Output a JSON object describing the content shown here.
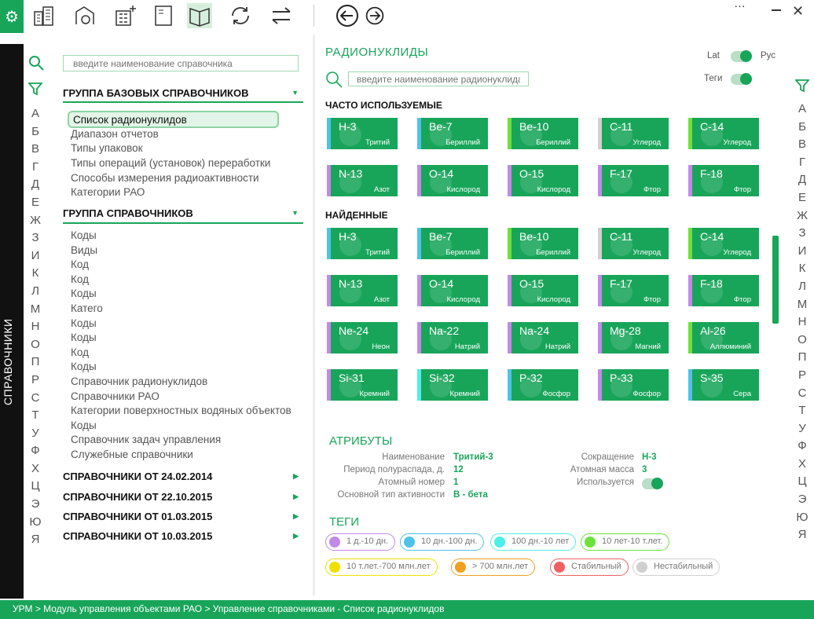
{
  "toolbar": {
    "settings_icon": "gear-icon"
  },
  "left": {
    "tab_label": "СПРАВОЧНИКИ",
    "search_placeholder": "введите наименование справочника",
    "alphabet": [
      "А",
      "Б",
      "В",
      "Г",
      "Д",
      "Е",
      "Ж",
      "З",
      "И",
      "К",
      "Л",
      "М",
      "Н",
      "О",
      "П",
      "Р",
      "С",
      "Т",
      "У",
      "Ф",
      "Х",
      "Ц",
      "Э",
      "Ю",
      "Я"
    ],
    "group1": {
      "title": "ГРУППА БАЗОВЫХ СПРАВОЧНИКОВ",
      "items": [
        "Список радионуклидов",
        "Диапазон отчетов",
        "Типы упаковок",
        "Типы операций (установок) переработки",
        "Способы измерения радиоактивности",
        "Категории РАО"
      ]
    },
    "group2": {
      "title": "ГРУППА СПРАВОЧНИКОВ",
      "items": [
        "Коды",
        "Виды",
        "Код",
        "Код",
        "Коды",
        "Катего",
        "Коды",
        "Коды",
        "Код",
        "Коды",
        "Справочник радионуклидов",
        "Справочники РАО",
        "Категории поверхностных водяных объектов",
        "Коды",
        "Справочник задач управления",
        "Служебные справочники"
      ]
    },
    "collapsed": [
      "СПРАВОЧНИКИ ОТ 24.02.2014",
      "СПРАВОЧНИКИ ОТ 22.10.2015",
      "СПРАВОЧНИКИ ОТ 01.03.2015",
      "СПРАВОЧНИКИ ОТ 10.03.2015"
    ]
  },
  "main": {
    "title": "РАДИОНУКЛИДЫ",
    "search_placeholder": "введите наименование радионуклида",
    "toggle_lat": "Lat",
    "toggle_rus": "Рус",
    "toggle_tags": "Теги",
    "frequent_title": "ЧАСТО ИСПОЛЬЗУЕМЫЕ",
    "found_title": "НАЙДЕННЫЕ",
    "frequent": [
      {
        "sym": "H-3",
        "name": "Тритий",
        "tag": "#4dc3e8"
      },
      {
        "sym": "Be-7",
        "name": "Бериллий",
        "tag": "#4dc3e8"
      },
      {
        "sym": "Be-10",
        "name": "Бериллий",
        "tag": "#6be23a"
      },
      {
        "sym": "C-11",
        "name": "Углерод",
        "tag": "#d0d0d0"
      },
      {
        "sym": "C-14",
        "name": "Углерод",
        "tag": "#6be23a"
      },
      {
        "sym": "N-13",
        "name": "Азот",
        "tag": "#c28ae8"
      },
      {
        "sym": "O-14",
        "name": "Кислород",
        "tag": "#c28ae8"
      },
      {
        "sym": "O-15",
        "name": "Кислород",
        "tag": "#c28ae8"
      },
      {
        "sym": "F-17",
        "name": "Фтор",
        "tag": "#c28ae8"
      },
      {
        "sym": "F-18",
        "name": "Фтор",
        "tag": "#c28ae8"
      }
    ],
    "found": [
      {
        "sym": "H-3",
        "name": "Тритий",
        "tag": "#4dc3e8"
      },
      {
        "sym": "Be-7",
        "name": "Бериллий",
        "tag": "#4dc3e8"
      },
      {
        "sym": "Be-10",
        "name": "Бериллий",
        "tag": "#6be23a"
      },
      {
        "sym": "C-11",
        "name": "Углерод",
        "tag": "#d0d0d0"
      },
      {
        "sym": "C-14",
        "name": "Углерод",
        "tag": "#6be23a"
      },
      {
        "sym": "N-13",
        "name": "Азот",
        "tag": "#c28ae8"
      },
      {
        "sym": "O-14",
        "name": "Кислород",
        "tag": "#c28ae8"
      },
      {
        "sym": "O-15",
        "name": "Кислород",
        "tag": "#c28ae8"
      },
      {
        "sym": "F-17",
        "name": "Фтор",
        "tag": "#c28ae8"
      },
      {
        "sym": "F-18",
        "name": "Фтор",
        "tag": "#c28ae8"
      },
      {
        "sym": "Ne-24",
        "name": "Неон",
        "tag": "#c28ae8"
      },
      {
        "sym": "Na-22",
        "name": "Натрий",
        "tag": "#c28ae8"
      },
      {
        "sym": "Na-24",
        "name": "Натрий",
        "tag": "#c28ae8"
      },
      {
        "sym": "Mg-28",
        "name": "Магний",
        "tag": "#c28ae8"
      },
      {
        "sym": "Al-26",
        "name": "Аллюминий",
        "tag": "#6be23a"
      },
      {
        "sym": "Si-31",
        "name": "Кремний",
        "tag": "#c28ae8"
      },
      {
        "sym": "Si-32",
        "name": "Кремний",
        "tag": "#4df0e8"
      },
      {
        "sym": "P-32",
        "name": "Фосфор",
        "tag": "#4dc3e8"
      },
      {
        "sym": "P-33",
        "name": "Фосфор",
        "tag": "#c28ae8"
      },
      {
        "sym": "S-35",
        "name": "Сера",
        "tag": "#4dc3e8"
      }
    ]
  },
  "attributes": {
    "title": "АТРИБУТЫ",
    "name_label": "Наименование",
    "name_value": "Тритий-3",
    "halflife_label": "Период полураспада, д.",
    "halflife_value": "12",
    "atomic_num_label": "Атомный номер",
    "atomic_num_value": "1",
    "activity_label": "Основной тип активности",
    "activity_value": "В - бета",
    "abbr_label": "Сокращение",
    "abbr_value": "Н-3",
    "mass_label": "Атомная масса",
    "mass_value": "3",
    "used_label": "Используется"
  },
  "tags": {
    "title": "ТЕГИ",
    "items": [
      {
        "label": "1 д.-10 дн.",
        "color": "#c28ae8"
      },
      {
        "label": "10 дн.-100 дн.",
        "color": "#4dc3e8"
      },
      {
        "label": "100 дн.-10 лет",
        "color": "#4df0e8"
      },
      {
        "label": "10 лет-10 т.лет.",
        "color": "#6be23a"
      },
      {
        "label": "10 т.лет.-700 млн.лет",
        "color": "#f0e000"
      },
      {
        "label": "> 700 млн.лет",
        "color": "#f0a020"
      },
      {
        "label": "Стабильный",
        "color": "#f06060"
      },
      {
        "label": "Нестабильный",
        "color": "#d0d0d0"
      }
    ]
  },
  "status": {
    "breadcrumb": "УРМ > Модуль управления объектами РАО > Управление справочниками - Список радионуклидов"
  }
}
